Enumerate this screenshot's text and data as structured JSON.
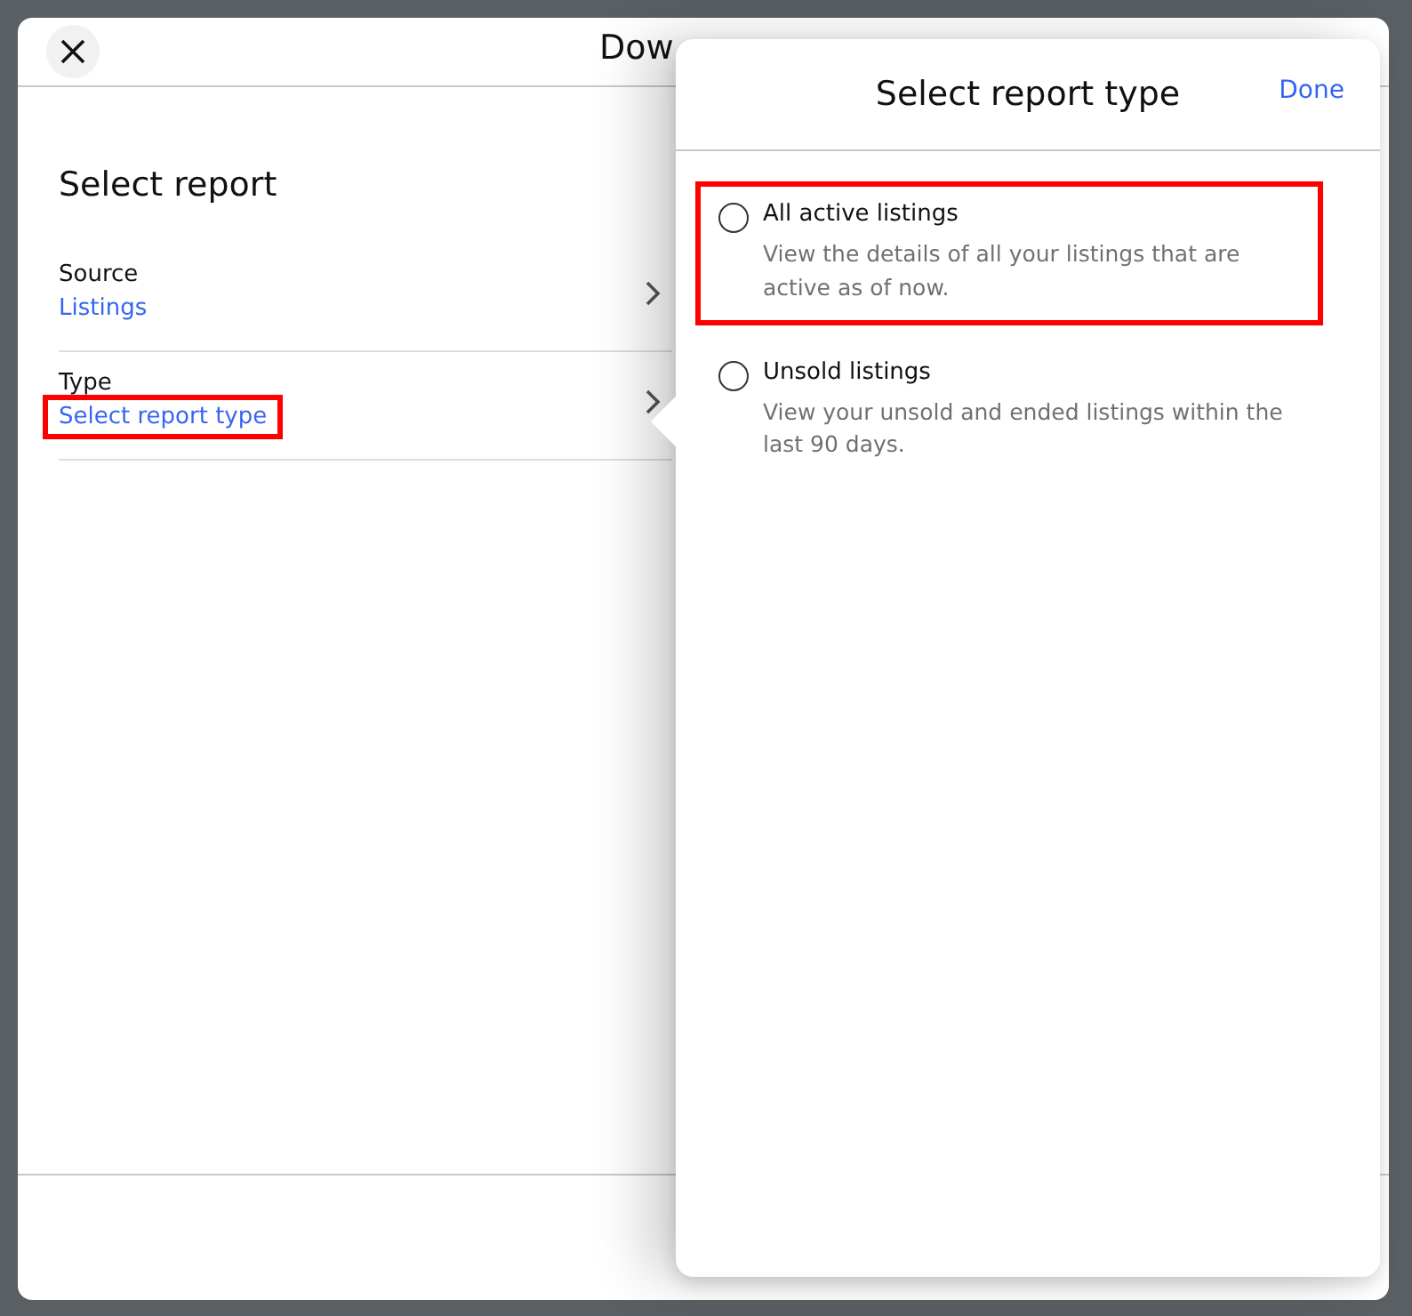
{
  "dialog": {
    "title": "Dow",
    "heading": "Select report",
    "fields": [
      {
        "label": "Source",
        "value": "Listings",
        "highlighted": false
      },
      {
        "label": "Type",
        "value": "Select report type",
        "highlighted": true
      }
    ]
  },
  "popover": {
    "title": "Select report type",
    "done": "Done",
    "options": [
      {
        "label": "All active listings",
        "description": "View the details of all your listings that are active as of now.",
        "selected": false,
        "highlighted": true
      },
      {
        "label": "Unsold listings",
        "description": "View your unsold and ended listings within the last 90 days.",
        "selected": false,
        "highlighted": false
      }
    ]
  }
}
